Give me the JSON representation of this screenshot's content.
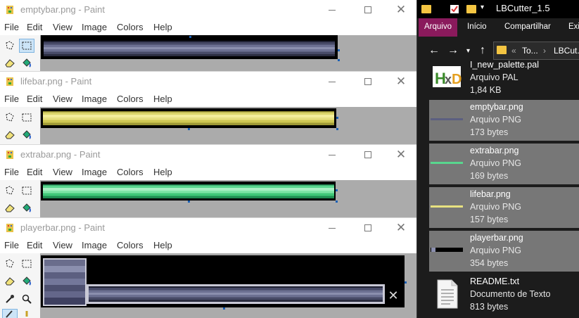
{
  "paint_menu": [
    "File",
    "Edit",
    "View",
    "Image",
    "Colors",
    "Help"
  ],
  "windows": [
    {
      "title": "emptybar.png - Paint",
      "bar": "empty"
    },
    {
      "title": "lifebar.png - Paint",
      "bar": "life"
    },
    {
      "title": "extrabar.png - Paint",
      "bar": "extra"
    },
    {
      "title": "playerbar.png - Paint",
      "bar": "player"
    }
  ],
  "explorer": {
    "title": "LBCutter_1.5",
    "ribbon_tabs": [
      "Arquivo",
      "Início",
      "Compartilhar",
      "Exib"
    ],
    "address_segments": [
      "«",
      "To...",
      "›",
      "LBCut..."
    ],
    "files": [
      {
        "name": "I_new_palette.pal",
        "type": "Arquivo PAL",
        "size": "1,84 KB"
      },
      {
        "name": "emptybar.png",
        "type": "Arquivo PNG",
        "size": "173 bytes"
      },
      {
        "name": "extrabar.png",
        "type": "Arquivo PNG",
        "size": "169 bytes"
      },
      {
        "name": "lifebar.png",
        "type": "Arquivo PNG",
        "size": "157 bytes"
      },
      {
        "name": "playerbar.png",
        "type": "Arquivo PNG",
        "size": "354 bytes"
      },
      {
        "name": "README.txt",
        "type": "Documento de Texto",
        "size": "813 bytes"
      }
    ]
  },
  "colors": {
    "ribbon_active": "#8a1a5c",
    "selection": "#cce4f7",
    "handle": "#1a5fb4",
    "explorer_bg": "#1c1c1c",
    "canvas_bg": "#ababab"
  },
  "icons": {
    "paint_app": "paint-palette-icon",
    "select": "free-select-icon",
    "rect_select": "rect-select-icon",
    "eraser": "eraser-icon",
    "fill": "fill-bucket-icon",
    "picker": "color-picker-icon",
    "zoom": "magnifier-icon"
  }
}
